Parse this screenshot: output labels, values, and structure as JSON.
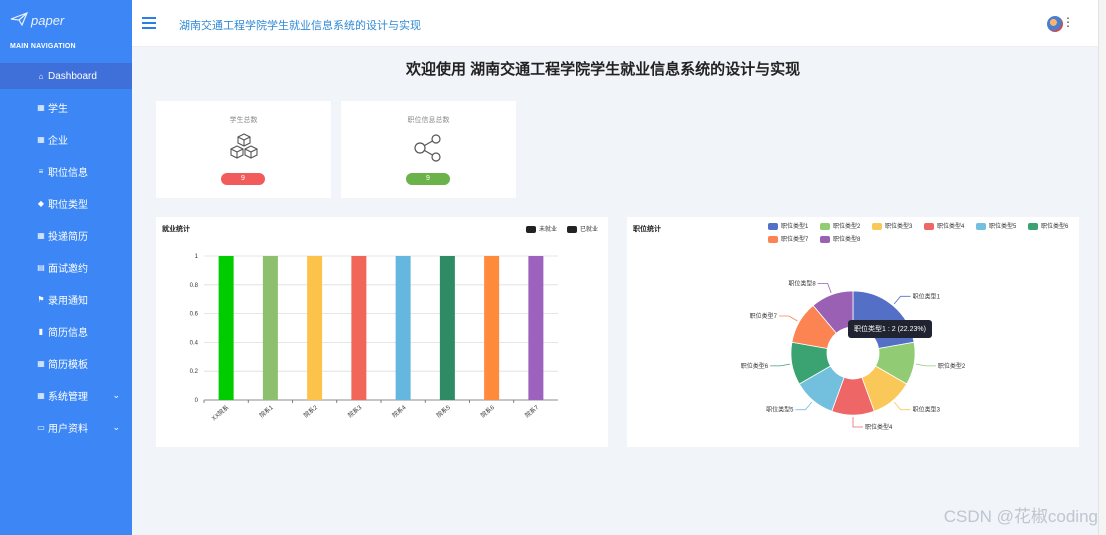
{
  "sidebar": {
    "logo_text": "paper",
    "nav_title": "MAIN NAVIGATION",
    "items": [
      {
        "label": "Dashboard",
        "icon": "⌂",
        "icon_name": "home-icon"
      },
      {
        "label": "学生",
        "icon": "▦",
        "icon_name": "grid-icon"
      },
      {
        "label": "企业",
        "icon": "▦",
        "icon_name": "grid-icon"
      },
      {
        "label": "职位信息",
        "icon": "≡",
        "icon_name": "list-icon"
      },
      {
        "label": "职位类型",
        "icon": "◆",
        "icon_name": "tag-icon"
      },
      {
        "label": "投递简历",
        "icon": "▦",
        "icon_name": "grid-icon"
      },
      {
        "label": "面试邀约",
        "icon": "▤",
        "icon_name": "table-icon"
      },
      {
        "label": "录用通知",
        "icon": "⚑",
        "icon_name": "flag-icon"
      },
      {
        "label": "简历信息",
        "icon": "▮",
        "icon_name": "file-icon"
      },
      {
        "label": "简历模板",
        "icon": "▦",
        "icon_name": "grid-icon"
      },
      {
        "label": "系统管理",
        "icon": "▦",
        "icon_name": "grid-icon"
      },
      {
        "label": "用户资料",
        "icon": "▭",
        "icon_name": "user-card-icon"
      }
    ]
  },
  "header": {
    "title": "湖南交通工程学院学生就业信息系统的设计与实现"
  },
  "main": {
    "page_title": "欢迎使用 湖南交通工程学院学生就业信息系统的设计与实现",
    "stats": [
      {
        "label": "学生总数",
        "value": "9",
        "color": "#f25b5b",
        "icon_name": "cubes-icon"
      },
      {
        "label": "职位信息总数",
        "value": "9",
        "color": "#6bb24a",
        "icon_name": "share-icon"
      }
    ]
  },
  "bar_chart_title": "就业统计",
  "pie_chart_title": "职位统计",
  "pie_tooltip": "职位类型1 : 2 (22.23%)",
  "watermark": "CSDN @花椒coding",
  "chart_data": [
    {
      "type": "bar",
      "title": "就业统计",
      "legend": [
        "未就业",
        "已就业"
      ],
      "legend_placement": "top-right",
      "categories": [
        "XX院系",
        "院系1",
        "院系2",
        "院系3",
        "院系4",
        "院系5",
        "院系6",
        "院系7"
      ],
      "values": [
        1,
        1,
        1,
        1,
        1,
        1,
        1,
        1
      ],
      "colors": [
        "#00cc00",
        "#8cc06e",
        "#fcc24a",
        "#f06658",
        "#66b7e0",
        "#2e8b63",
        "#ff8a3c",
        "#9d62be"
      ],
      "yticks": [
        "0",
        "0.2",
        "0.4",
        "0.6",
        "0.8",
        "1"
      ],
      "ylim": [
        0,
        1
      ],
      "grid": true
    },
    {
      "type": "pie",
      "title": "职位统计",
      "legend_placement": "top-right",
      "labels": [
        "职位类型1",
        "职位类型2",
        "职位类型3",
        "职位类型4",
        "职位类型5",
        "职位类型6",
        "职位类型7",
        "职位类型8"
      ],
      "values": [
        2,
        1,
        1,
        1,
        1,
        1,
        1,
        1
      ],
      "colors": [
        "#5470c6",
        "#91cc75",
        "#fac858",
        "#ee6666",
        "#73c0de",
        "#3ba272",
        "#fc8452",
        "#9a60b4"
      ],
      "donut": true
    }
  ]
}
